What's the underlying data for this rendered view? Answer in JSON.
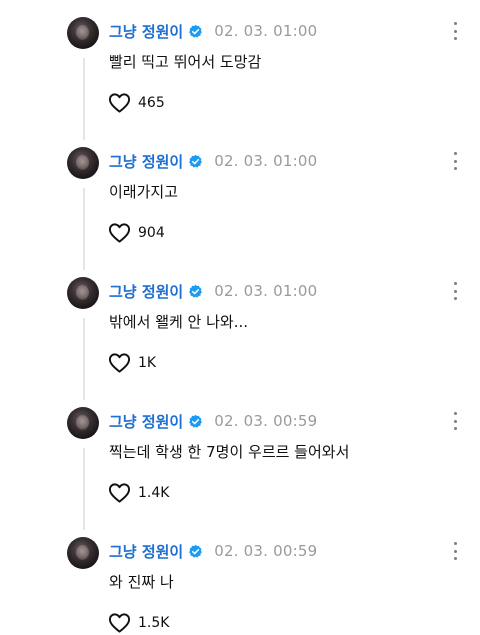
{
  "thread": {
    "posts": [
      {
        "author": "그냥 정원이",
        "timestamp": "02. 03. 01:00",
        "text": "빨리 띡고 뛰어서 도망감",
        "likes": "465"
      },
      {
        "author": "그냥 정원이",
        "timestamp": "02. 03. 01:00",
        "text": "이래가지고",
        "likes": "904"
      },
      {
        "author": "그냥 정원이",
        "timestamp": "02. 03. 01:00",
        "text": "밖에서 왤케 안 나와...",
        "likes": "1K"
      },
      {
        "author": "그냥 정원이",
        "timestamp": "02. 03. 00:59",
        "text": "찍는데 학생 한 7명이 우르르 들어와서",
        "likes": "1.4K"
      },
      {
        "author": "그냥 정원이",
        "timestamp": "02. 03. 00:59",
        "text": "와 진짜 나",
        "likes": "1.5K"
      }
    ]
  },
  "colors": {
    "author_name": "#1d6fd1",
    "verified_badge": "#1d9bf0",
    "timestamp": "#9a9a9a",
    "thread_line": "#e6e6e6"
  },
  "icons": {
    "verified": "verified-badge-icon",
    "like": "heart-icon",
    "more": "more-options-icon"
  }
}
